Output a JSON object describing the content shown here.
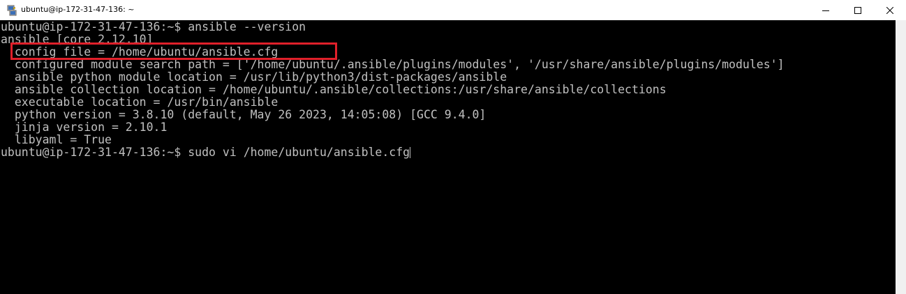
{
  "window": {
    "title": "ubuntu@ip-172-31-47-136: ~",
    "icon": "putty-icon",
    "controls": {
      "minimize": "minimize-icon",
      "maximize": "maximize-icon",
      "close": "close-icon"
    }
  },
  "terminal": {
    "prompt_1": "ubuntu@ip-172-31-47-136:~$ ",
    "command_1": "ansible --version",
    "lines": [
      "ansible [core 2.12.10]",
      "  config file = /home/ubuntu/ansible.cfg",
      "  configured module search path = ['/home/ubuntu/.ansible/plugins/modules', '/usr/share/ansible/plugins/modules']",
      "  ansible python module location = /usr/lib/python3/dist-packages/ansible",
      "  ansible collection location = /home/ubuntu/.ansible/collections:/usr/share/ansible/collections",
      "  executable location = /usr/bin/ansible",
      "  python version = 3.8.10 (default, May 26 2023, 14:05:08) [GCC 9.4.0]",
      "  jinja version = 2.10.1",
      "  libyaml = True"
    ],
    "prompt_2": "ubuntu@ip-172-31-47-136:~$ ",
    "command_2": "sudo vi /home/ubuntu/ansible.cfg"
  },
  "colors": {
    "terminal_bg": "#000000",
    "terminal_fg": "#c0c0c0",
    "highlight": "#e0202a",
    "titlebar_bg": "#ffffff"
  }
}
